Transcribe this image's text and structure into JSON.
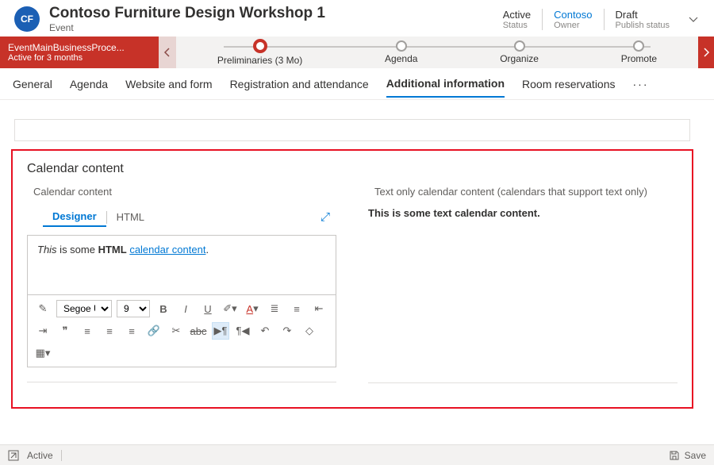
{
  "header": {
    "avatar_initials": "CF",
    "title": "Contoso Furniture Design Workshop 1",
    "subtitle": "Event",
    "meta": [
      {
        "value": "Active",
        "label": "Status",
        "link": false
      },
      {
        "value": "Contoso",
        "label": "Owner",
        "link": true
      },
      {
        "value": "Draft",
        "label": "Publish status",
        "link": false
      }
    ]
  },
  "process": {
    "name": "EventMainBusinessProce...",
    "active_for": "Active for 3 months",
    "stages": [
      {
        "label": "Preliminaries  (3 Mo)",
        "active": true
      },
      {
        "label": "Agenda",
        "active": false
      },
      {
        "label": "Organize",
        "active": false
      },
      {
        "label": "Promote",
        "active": false
      }
    ]
  },
  "tabs": [
    "General",
    "Agenda",
    "Website and form",
    "Registration and attendance",
    "Additional information",
    "Room reservations"
  ],
  "active_tab": "Additional information",
  "section": {
    "title": "Calendar content",
    "left_label": "Calendar content",
    "right_label": "Text only calendar content (calendars that support text only)",
    "editor": {
      "tabs": [
        "Designer",
        "HTML"
      ],
      "active": "Designer",
      "html_prefix_italic": "This",
      "html_mid1": " is some ",
      "html_bold": "HTML",
      "html_link": "calendar content",
      "html_suffix": ".",
      "font": "Segoe UI",
      "size": "9"
    },
    "text_content": "This is some text calendar content."
  },
  "footer": {
    "status": "Active",
    "save": "Save"
  }
}
